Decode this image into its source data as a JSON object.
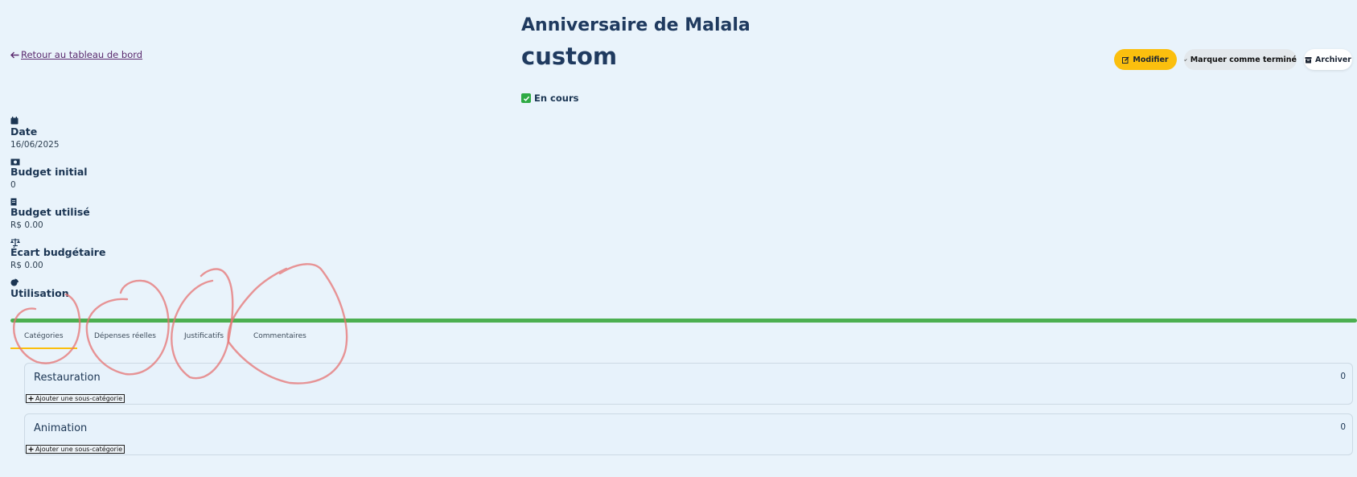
{
  "header": {
    "back_label": "Retour au tableau de bord",
    "title": "Anniversaire de Malala",
    "event_type": "custom",
    "status": "En cours"
  },
  "actions": {
    "edit_label": "Modifier",
    "complete_label": "Marquer comme terminé",
    "archive_label": "Archiver"
  },
  "info": [
    {
      "icon": "calendar-icon",
      "label": "Date",
      "value": "16/06/2025"
    },
    {
      "icon": "money-icon",
      "label": "Budget initial",
      "value": "0"
    },
    {
      "icon": "receipt-icon",
      "label": "Budget utilisé",
      "value": "R$ 0.00"
    },
    {
      "icon": "balance-scale-icon",
      "label": "Écart budgétaire",
      "value": "R$ 0.00"
    },
    {
      "icon": "pie-chart-icon",
      "label": "Utilisation"
    }
  ],
  "usage": {
    "progress_fraction": 1.0,
    "color": "#4caf50"
  },
  "tabs": [
    "Catégories",
    "Dépenses réelles",
    "Justificatifs",
    "Commentaires"
  ],
  "active_tab": "Catégories",
  "categories": [
    {
      "name": "Restauration",
      "amount": "0",
      "add_label": "Ajouter une sous-catégorie"
    },
    {
      "name": "Animation",
      "amount": "0",
      "add_label": "Ajouter une sous-catégorie"
    }
  ],
  "colors": {
    "accent": "#fbbf0e",
    "background": "#e9f3fb",
    "heading": "#1f3a5f",
    "status": "#2eaa44"
  }
}
